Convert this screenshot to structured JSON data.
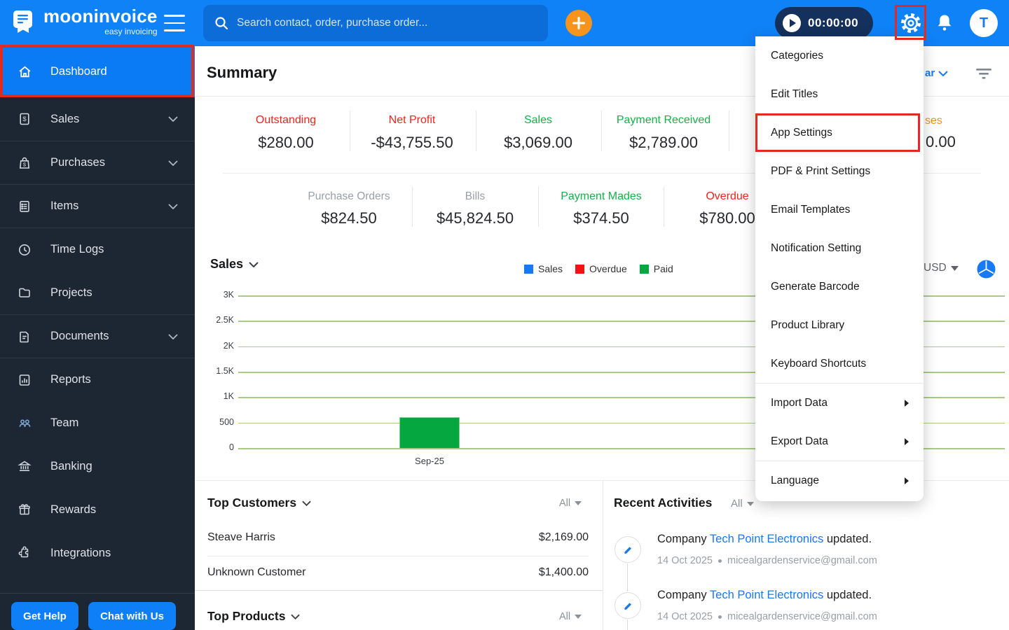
{
  "header": {
    "brand": {
      "name": "mooninvoice",
      "tagline": "easy invoicing"
    },
    "search": {
      "placeholder": "Search contact, order, purchase order..."
    },
    "timer": {
      "value": "00:00:00"
    },
    "avatar": "T"
  },
  "sidebar": {
    "items": [
      {
        "label": "Dashboard",
        "icon": "home-icon",
        "active": true
      },
      {
        "label": "Sales",
        "icon": "invoice-icon",
        "chevron": true
      },
      {
        "label": "Purchases",
        "icon": "shopping-bag-icon",
        "chevron": true
      },
      {
        "label": "Items",
        "icon": "list-icon",
        "chevron": true
      },
      {
        "label": "Time Logs",
        "icon": "clock-icon"
      },
      {
        "label": "Projects",
        "icon": "folder-icon"
      },
      {
        "label": "Documents",
        "icon": "document-icon",
        "chevron": true
      },
      {
        "label": "Reports",
        "icon": "bar-chart-icon"
      },
      {
        "label": "Team",
        "icon": "people-icon"
      },
      {
        "label": "Banking",
        "icon": "bank-icon"
      },
      {
        "label": "Rewards",
        "icon": "gift-icon"
      },
      {
        "label": "Integrations",
        "icon": "puzzle-icon"
      }
    ],
    "footer": {
      "get_help": "Get Help",
      "chat": "Chat with Us"
    }
  },
  "summary": {
    "title": "Summary",
    "period_fragment": "ar",
    "row1": [
      {
        "label": "Outstanding",
        "value": "$280.00",
        "color": "red"
      },
      {
        "label": "Net Profit",
        "value": "-$43,755.50",
        "color": "red"
      },
      {
        "label": "Sales",
        "value": "$3,069.00",
        "color": "green"
      },
      {
        "label": "Payment Received",
        "value": "$2,789.00",
        "color": "green"
      }
    ],
    "row1_fragment": {
      "label": "ses",
      "value": "0.00",
      "color": "orange"
    },
    "row2": [
      {
        "label": "Purchase Orders",
        "value": "$824.50",
        "color": "gray"
      },
      {
        "label": "Bills",
        "value": "$45,824.50",
        "color": "gray"
      },
      {
        "label": "Payment Mades",
        "value": "$374.50",
        "color": "green"
      },
      {
        "label": "Overdue",
        "value": "$780.00",
        "color": "red"
      }
    ]
  },
  "sales_chart": {
    "title": "Sales",
    "currency": "USD",
    "legend": [
      {
        "label": "Sales",
        "color": "#147af6"
      },
      {
        "label": "Overdue",
        "color": "#f01414"
      },
      {
        "label": "Paid",
        "color": "#04a740"
      }
    ],
    "y_ticks": [
      "3K",
      "2.5K",
      "2K",
      "1.5K",
      "1K",
      "500",
      "0"
    ],
    "x_labels": [
      "Sep-25"
    ]
  },
  "chart_data": {
    "type": "bar",
    "title": "Sales",
    "categories": [
      "Sep-25"
    ],
    "series": [
      {
        "name": "Sales",
        "color": "#147af6",
        "values": [
          0
        ]
      },
      {
        "name": "Overdue",
        "color": "#f01414",
        "values": [
          0
        ]
      },
      {
        "name": "Paid",
        "color": "#04a740",
        "values": [
          610
        ]
      }
    ],
    "ylim": [
      0,
      3000
    ],
    "grid": "horizontal",
    "legend_position": "top-right",
    "currency": "USD"
  },
  "top_customers": {
    "title": "Top Customers",
    "filter": "All",
    "rows": [
      {
        "name": "Steave Harris",
        "amount": "$2,169.00"
      },
      {
        "name": "Unknown Customer",
        "amount": "$1,400.00"
      }
    ]
  },
  "top_products": {
    "title": "Top Products",
    "filter": "All"
  },
  "recent_activities": {
    "title": "Recent Activities",
    "filter": "All",
    "items": [
      {
        "prefix": "Company",
        "entity": "Tech Point Electronics",
        "suffix": "updated.",
        "date": "14 Oct 2025",
        "email": "micealgardenservice@gmail.com"
      },
      {
        "prefix": "Company",
        "entity": "Tech Point Electronics",
        "suffix": "updated.",
        "date": "14 Oct 2025",
        "email": "micealgardenservice@gmail.com"
      }
    ]
  },
  "settings_menu": {
    "items": [
      {
        "label": "Categories"
      },
      {
        "label": "Edit Titles"
      },
      {
        "label": "App Settings",
        "highlighted": true
      },
      {
        "label": "PDF & Print Settings"
      },
      {
        "label": "Email Templates"
      },
      {
        "label": "Notification Setting"
      },
      {
        "label": "Generate Barcode"
      },
      {
        "label": "Product Library"
      },
      {
        "label": "Keyboard Shortcuts"
      },
      {
        "label": "Import Data",
        "submenu": true
      },
      {
        "label": "Export Data",
        "submenu": true
      },
      {
        "label": "Language",
        "submenu": true
      }
    ]
  },
  "colors": {
    "header_blue": "#0f82f7",
    "sidebar_dark": "#1d2633",
    "accent_orange": "#f7941d",
    "highlight_red": "#e02b20",
    "positive_green": "#12b347",
    "negative_red": "#f5221b",
    "link_blue": "#1779f3",
    "grid_green": "#a9cc85",
    "bar_green": "#04a740"
  }
}
